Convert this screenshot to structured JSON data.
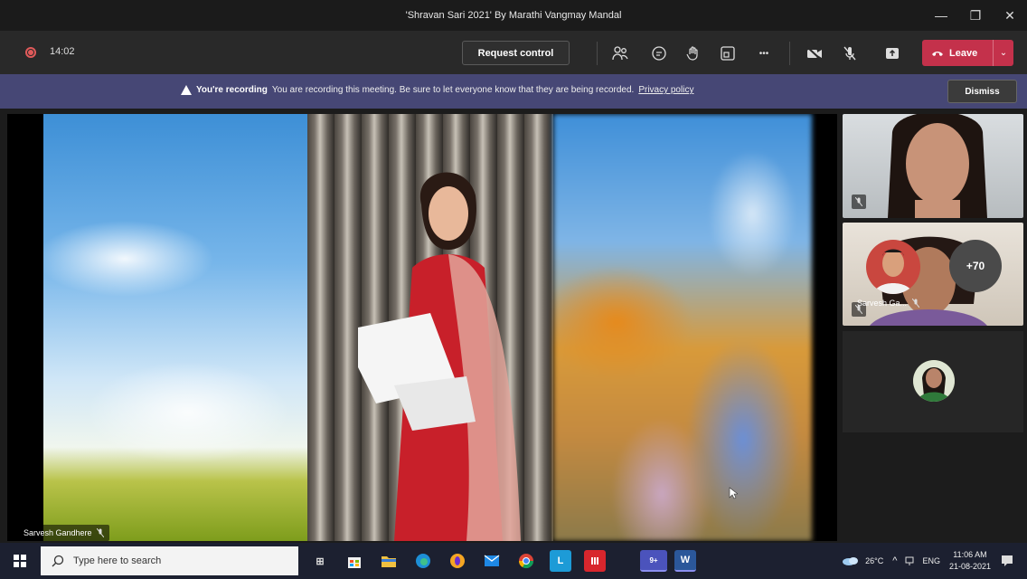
{
  "window": {
    "title": "'Shravan Sari 2021' By Marathi Vangmay Mandal",
    "minimize_glyph": "—",
    "maximize_glyph": "❐",
    "close_glyph": "✕"
  },
  "toolbar": {
    "timer": "14:02",
    "request_control_label": "Request control",
    "more_glyph": "•••",
    "leave_label": "Leave",
    "leave_caret": "⌄",
    "leave_color": "#c4314b"
  },
  "banner": {
    "strong": "You're recording",
    "message": "You are recording this meeting. Be sure to let everyone know that they are being recorded.",
    "link": "Privacy policy",
    "dismiss_label": "Dismiss",
    "background": "#464775"
  },
  "stage": {
    "main_speaker_name": "Sarvesh Gandhere",
    "participant_name": "Sarvesh Ga...",
    "overflow_count": "+70"
  },
  "taskbar": {
    "search_placeholder": "Type here to search",
    "apps": [
      {
        "name": "task-view",
        "label": "⊞"
      },
      {
        "name": "store",
        "label": ""
      },
      {
        "name": "file-explorer",
        "label": ""
      },
      {
        "name": "edge",
        "label": ""
      },
      {
        "name": "opera",
        "label": ""
      },
      {
        "name": "mail",
        "label": ""
      },
      {
        "name": "chrome",
        "label": ""
      },
      {
        "name": "l-app",
        "label": "L"
      },
      {
        "name": "office",
        "label": ""
      },
      {
        "name": "teams",
        "label": "9+"
      },
      {
        "name": "word",
        "label": "W"
      }
    ],
    "weather": "26°C",
    "language": "ENG",
    "time": "11:06 AM",
    "date": "21-08-2021"
  }
}
